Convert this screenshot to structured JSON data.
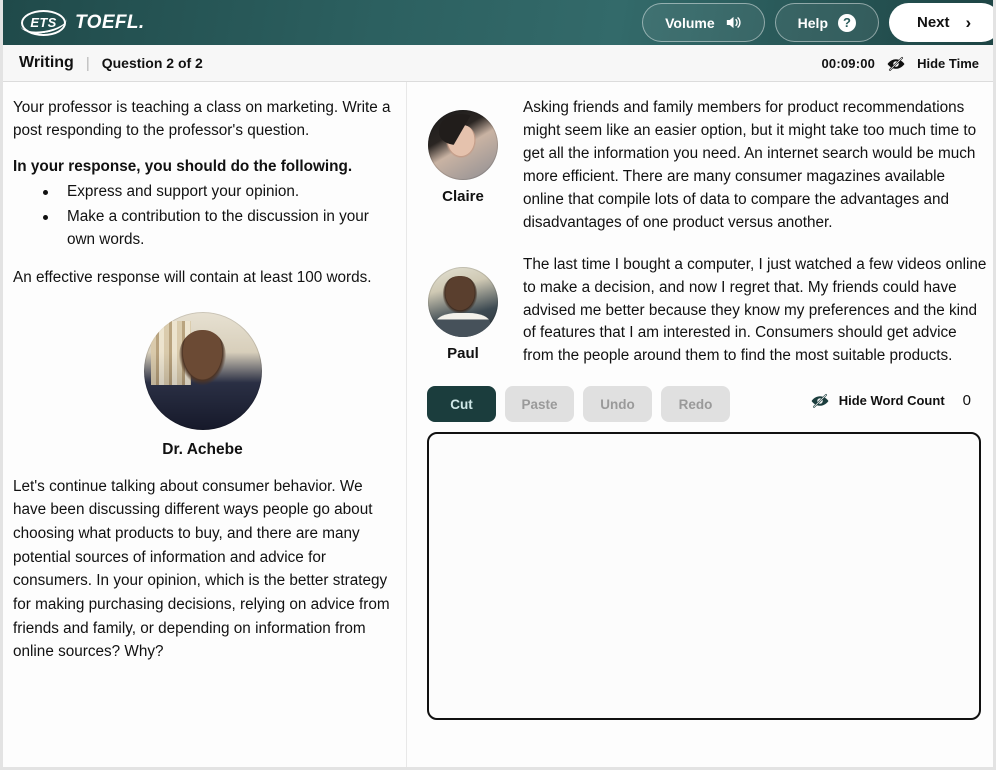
{
  "header": {
    "brand_ets": "ETS",
    "brand_toefl": "TOEFL.",
    "volume_label": "Volume",
    "help_label": "Help",
    "help_icon_glyph": "?",
    "next_label": "Next",
    "next_chevron": "›",
    "accent_color": "#2c6060"
  },
  "subheader": {
    "section": "Writing",
    "separator": "|",
    "question": "Question 2 of 2",
    "timer": "00:09:00",
    "hide_time_label": "Hide Time"
  },
  "left_pane": {
    "intro": "Your professor is teaching a class on marketing. Write a post responding to the professor's question.",
    "directions_heading": "In your response, you should do the following.",
    "bullets": [
      "Express and support your opinion.",
      "Make a contribution to the discussion in your own words."
    ],
    "word_requirement": "An effective response will contain at least 100 words.",
    "professor_name": "Dr. Achebe",
    "professor_question": "Let's continue talking about consumer behavior. We have been discussing different ways people go about choosing what products to buy, and there are many potential sources of information and advice for consumers. In your opinion, which is the better strategy for making purchasing decisions, relying on advice from friends and family, or depending on information from online sources? Why?"
  },
  "discussion": {
    "posts": [
      {
        "author": "Claire",
        "text": "Asking friends and family members for product recommendations might seem like an easier option, but it might take too much time to get all the information you need. An internet search would be much more efficient. There are many consumer magazines available online that compile lots of data to compare the advantages and disadvantages of one product versus another."
      },
      {
        "author": "Paul",
        "text": "The last time I bought a computer, I just watched a few videos online to make a decision, and now I regret that. My friends could have advised me better because they know my preferences and the kind of features that I am interested in. Consumers should get advice from the people around them to find the most suitable products."
      }
    ]
  },
  "editor": {
    "cut_label": "Cut",
    "paste_label": "Paste",
    "undo_label": "Undo",
    "redo_label": "Redo",
    "hide_word_count_label": "Hide Word Count",
    "word_count": "0",
    "answer_value": "",
    "answer_placeholder": ""
  }
}
